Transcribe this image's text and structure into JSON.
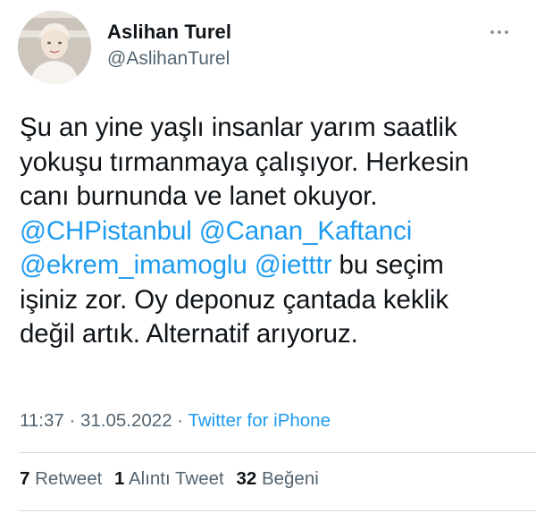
{
  "author": {
    "display_name": "Aslihan Turel",
    "handle": "@AslihanTurel"
  },
  "tweet": {
    "lines": [
      [
        {
          "t": "Şu an yine yaşlı insanlar yarım saatlik"
        }
      ],
      [
        {
          "t": "yokuşu tırmanmaya çalışıyor. Herkesin"
        }
      ],
      [
        {
          "t": "canı burnunda ve lanet okuyor."
        }
      ],
      [
        {
          "t": "@CHPistanbul",
          "m": true
        },
        {
          "t": " "
        },
        {
          "t": "@Canan_Kaftanci",
          "m": true
        }
      ],
      [
        {
          "t": "@ekrem_imamoglu",
          "m": true
        },
        {
          "t": " "
        },
        {
          "t": "@ietttr",
          "m": true
        },
        {
          "t": " bu seçim"
        }
      ],
      [
        {
          "t": "işiniz zor. Oy deponuz çantada keklik"
        }
      ],
      [
        {
          "t": "değil artık. Alternatif arıyoruz."
        }
      ]
    ]
  },
  "meta": {
    "time": "11:37",
    "sep1": " · ",
    "date": "31.05.2022",
    "sep2": " · ",
    "source": "Twitter for iPhone"
  },
  "stats": {
    "retweets": "7",
    "retweets_label": " Retweet",
    "quotes": "1",
    "quotes_label": " Alıntı Tweet",
    "likes": "32",
    "likes_label": " Beğeni"
  },
  "colors": {
    "text": "#0f1419",
    "secondary": "#536471",
    "link": "#1d9bf0",
    "divider": "#cfd9de"
  },
  "icons": {
    "more": "more-dots-icon"
  }
}
